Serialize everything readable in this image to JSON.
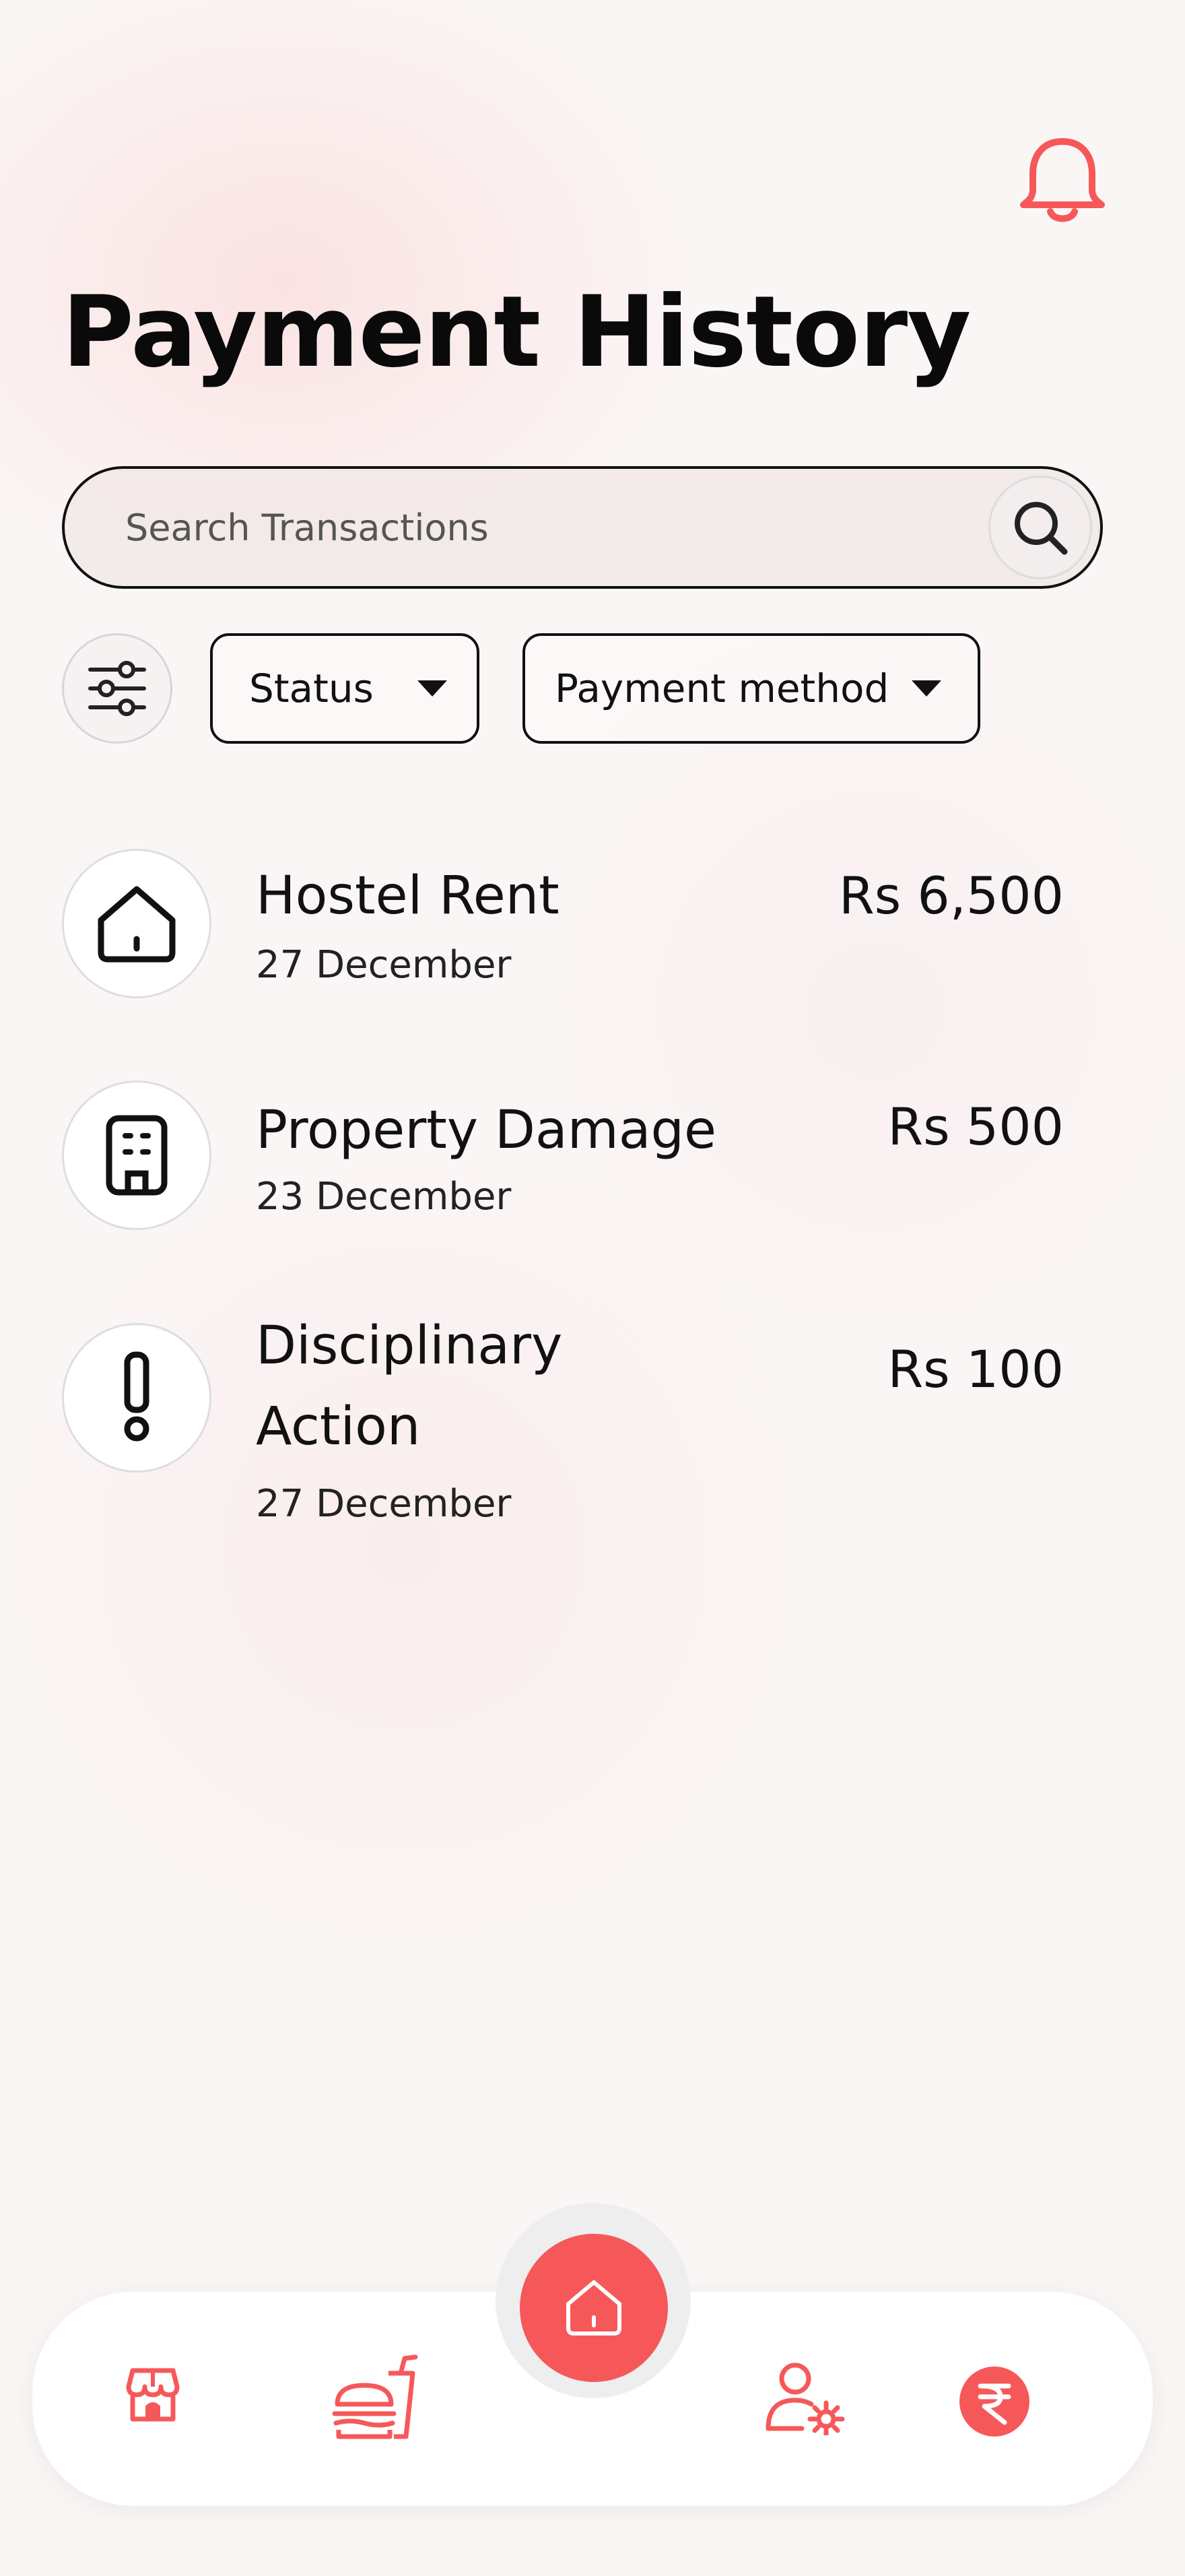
{
  "header": {
    "title": "Payment History",
    "notification_icon": "bell-icon"
  },
  "search": {
    "placeholder": "Search Transactions",
    "icon": "search-icon"
  },
  "filters": {
    "filter_icon": "sliders-icon",
    "status_label": "Status",
    "method_label": "Payment method"
  },
  "transactions": [
    {
      "icon": "house-icon",
      "title": "Hostel Rent",
      "date": "27 December",
      "amount": "Rs 6,500"
    },
    {
      "icon": "building-icon",
      "title": "Property Damage",
      "date": "23 December",
      "amount": "Rs 500"
    },
    {
      "icon": "exclamation-icon",
      "title_line1": "Disciplinary",
      "title_line2": "Action",
      "date": "27 December",
      "amount": "Rs 100"
    }
  ],
  "bottom_nav": {
    "items": [
      {
        "icon": "store-icon"
      },
      {
        "icon": "food-icon"
      },
      {
        "icon": "home-icon"
      },
      {
        "icon": "user-settings-icon"
      },
      {
        "icon": "rupee-icon"
      }
    ]
  },
  "colors": {
    "accent": "#f6585a",
    "text": "#111111"
  }
}
